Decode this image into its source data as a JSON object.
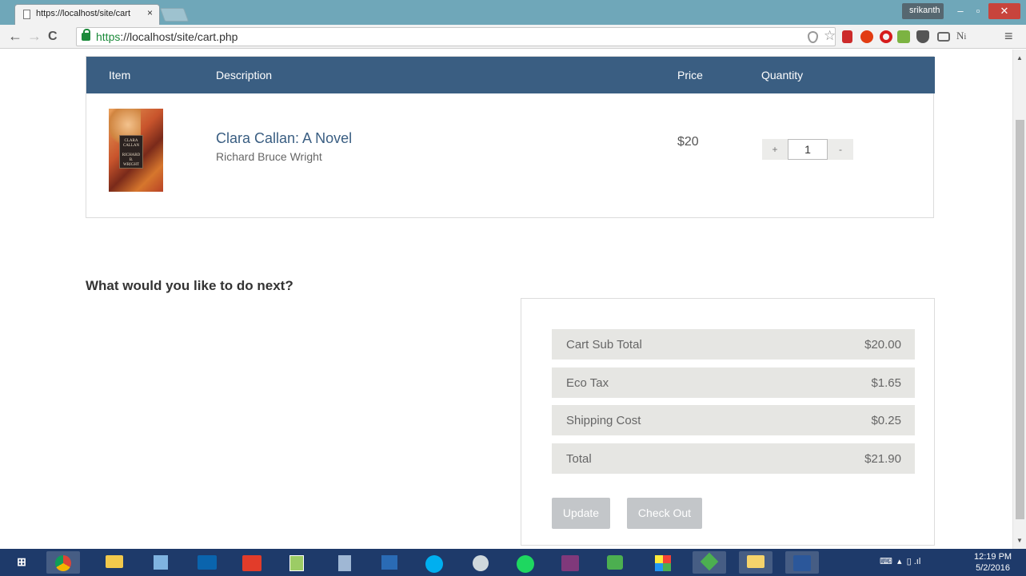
{
  "browser": {
    "tab_title": "https://localhost/site/cart",
    "tab_close": "×",
    "url_scheme": "https",
    "url_rest": "://localhost/site/cart.php",
    "profile_name": "srikanth",
    "menu_glyph": "≡",
    "extension_icons": [
      "shield-icon",
      "star-icon",
      "bookmark-icon",
      "ublock-icon",
      "opera-icon",
      "lastpass-icon",
      "pocket-icon",
      "cast-icon",
      "ni-icon"
    ]
  },
  "cart": {
    "headers": {
      "item": "Item",
      "description": "Description",
      "price": "Price",
      "quantity": "Quantity"
    },
    "items": [
      {
        "title": "Clara Callan: A Novel",
        "author": "Richard Bruce Wright",
        "price": "$20",
        "quantity": "1",
        "plus": "+",
        "minus": "-",
        "cover_text": "CLARA CALLAN · RICHARD B. WRIGHT"
      }
    ]
  },
  "next_heading": "What would you like to do next?",
  "summary": {
    "rows": [
      {
        "label": "Cart Sub Total",
        "value": "$20.00"
      },
      {
        "label": "Eco Tax",
        "value": "$1.65"
      },
      {
        "label": "Shipping Cost",
        "value": "$0.25"
      },
      {
        "label": "Total",
        "value": "$21.90"
      }
    ],
    "update_label": "Update",
    "checkout_label": "Check Out"
  },
  "taskbar": {
    "apps": [
      "windows-start-icon",
      "chrome-icon",
      "file-explorer-icon",
      "remote-desktop-icon",
      "outlook-icon",
      "imdb-icon",
      "notepad-icon",
      "calculator-icon",
      "powershell-icon",
      "skype-icon",
      "network-icon",
      "spotify-icon",
      "onenote-icon",
      "chat-icon",
      "multicolor-app-icon",
      "green-app-icon",
      "folder-icon",
      "word-icon"
    ],
    "time": "12:19 PM",
    "date": "5/2/2016"
  },
  "colors": {
    "header_bar": "#3a5e82",
    "summary_row_bg": "#e6e6e3",
    "button_bg": "#c3c6c9",
    "tab_strip": "#6fa7b9",
    "taskbar": "#1e3a6a"
  }
}
